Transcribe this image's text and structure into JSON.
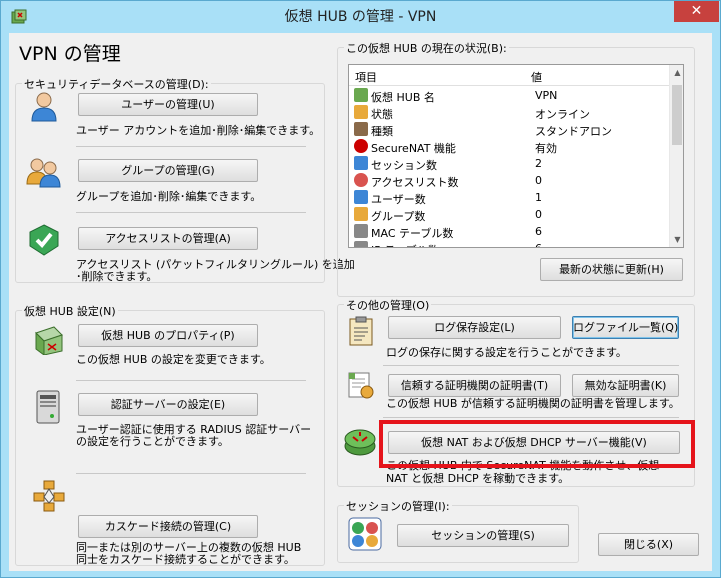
{
  "window": {
    "title": "仮想 HUB の管理 - VPN",
    "close_glyph": "✕"
  },
  "heading": "VPN の管理",
  "security_db": {
    "legend": "セキュリティデータベースの管理(D):",
    "users_button": "ユーザーの管理(U)",
    "users_desc": "ユーザー アカウントを追加･削除･編集できます。",
    "groups_button": "グループの管理(G)",
    "groups_desc": "グループを追加･削除･編集できます。",
    "acl_button": "アクセスリストの管理(A)",
    "acl_desc_1": "アクセスリスト (パケットフィルタリングルール) を追加",
    "acl_desc_2": "･削除できます。"
  },
  "hub_settings": {
    "legend": "仮想 HUB 設定(N)",
    "props_button": "仮想 HUB のプロパティ(P)",
    "props_desc": "この仮想 HUB の設定を変更できます。",
    "auth_button": "認証サーバーの設定(E)",
    "auth_desc_1": "ユーザー認証に使用する RADIUS 認証サーバー",
    "auth_desc_2": "の設定を行うことができます。",
    "cascade_button": "カスケード接続の管理(C)",
    "cascade_desc_1": "同一または別のサーバー上の複数の仮想 HUB",
    "cascade_desc_2": "同士をカスケード接続することができます。"
  },
  "status": {
    "legend": "この仮想 HUB の現在の状況(B):",
    "col_item": "項目",
    "col_value": "値",
    "rows": [
      {
        "item": "仮想 HUB 名",
        "value": "VPN",
        "icon": "hub-icon"
      },
      {
        "item": "状態",
        "value": "オンライン",
        "icon": "status-icon"
      },
      {
        "item": "種類",
        "value": "スタンドアロン",
        "icon": "type-icon"
      },
      {
        "item": "SecureNAT 機能",
        "value": "有効",
        "icon": "securenat-icon"
      },
      {
        "item": "セッション数",
        "value": "2",
        "icon": "session-icon"
      },
      {
        "item": "アクセスリスト数",
        "value": "0",
        "icon": "acl-icon"
      },
      {
        "item": "ユーザー数",
        "value": "1",
        "icon": "user-icon"
      },
      {
        "item": "グループ数",
        "value": "0",
        "icon": "group-icon"
      },
      {
        "item": "MAC テーブル数",
        "value": "6",
        "icon": "mac-table-icon"
      },
      {
        "item": "IP テーブル数",
        "value": "6",
        "icon": "ip-table-icon"
      }
    ],
    "refresh_button": "最新の状態に更新(H)"
  },
  "other": {
    "legend": "その他の管理(O)",
    "log_settings_button": "ログ保存設定(L)",
    "log_files_button": "ログファイル一覧(Q)",
    "log_desc": "ログの保存に関する設定を行うことができます。",
    "trusted_ca_button": "信頼する証明機関の証明書(T)",
    "invalid_cert_button": "無効な証明書(K)",
    "cert_desc": "この仮想 HUB が信頼する証明機関の証明書を管理します。",
    "nat_button": "仮想 NAT および仮想 DHCP サーバー機能(V)",
    "nat_desc_1": "この仮想 HUB 内で SecureNAT 機能を動作させ、仮想",
    "nat_desc_2": "NAT と仮想 DHCP を稼動できます。"
  },
  "session": {
    "legend": "セッションの管理(I):",
    "sessions_button": "セッションの管理(S)"
  },
  "close_button": "閉じる(X)",
  "colors": {
    "highlight": "#e5141b",
    "titlebar": "#a9e0f7",
    "close": "#c7413e"
  }
}
